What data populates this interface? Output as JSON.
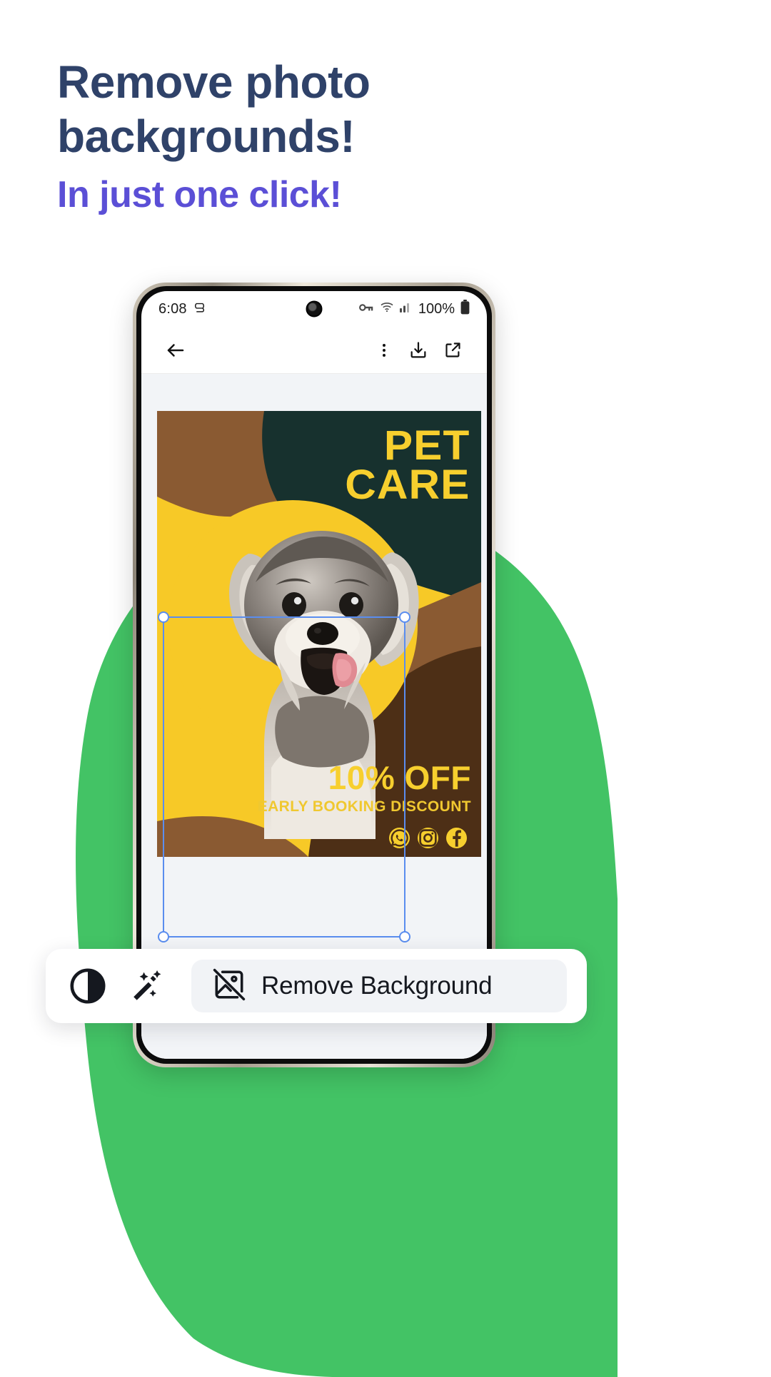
{
  "promo": {
    "headline_line1": "Remove photo",
    "headline_line2": "backgrounds!",
    "subheadline": "In just one click!",
    "headline_color": "#2f4269",
    "subheadline_color": "#5b4fd6",
    "background_blob_color": "#43c365"
  },
  "phone": {
    "statusbar": {
      "time": "6:08",
      "alarm_icon": "alarm-icon",
      "camera_punchhole": "camera-punchhole",
      "key_icon": "key-icon",
      "wifi_icon": "wifi-icon",
      "signal_icon": "cellular-signal-icon",
      "battery_percent": "100%",
      "battery_icon": "battery-full-icon"
    },
    "toolbar": {
      "back_icon": "back-arrow-icon",
      "overflow_icon": "more-vertical-icon",
      "download_icon": "download-icon",
      "share_icon": "share-external-icon"
    }
  },
  "poster": {
    "title_line1": "PET",
    "title_line2": "CARE",
    "discount": "10% OFF",
    "discount_sub": "EARLY BOOKING DISCOUNT",
    "socials": [
      "whatsapp-icon",
      "instagram-icon",
      "facebook-icon"
    ],
    "colors": {
      "yellow": "#f7c927",
      "dark_green": "#17312e",
      "brown_light": "#8a5a32",
      "brown_dark": "#4d2f16",
      "text_yellow": "#f7cf2e"
    }
  },
  "selection": {
    "handle_color": "#5a8def",
    "handles": [
      "top-left",
      "top-right",
      "bottom-left",
      "bottom-right"
    ]
  },
  "bottom_toolbar": {
    "contrast_icon": "contrast-icon",
    "magic_wand_icon": "magic-wand-icon",
    "remove_bg_icon": "image-off-icon",
    "remove_bg_label": "Remove Background"
  }
}
